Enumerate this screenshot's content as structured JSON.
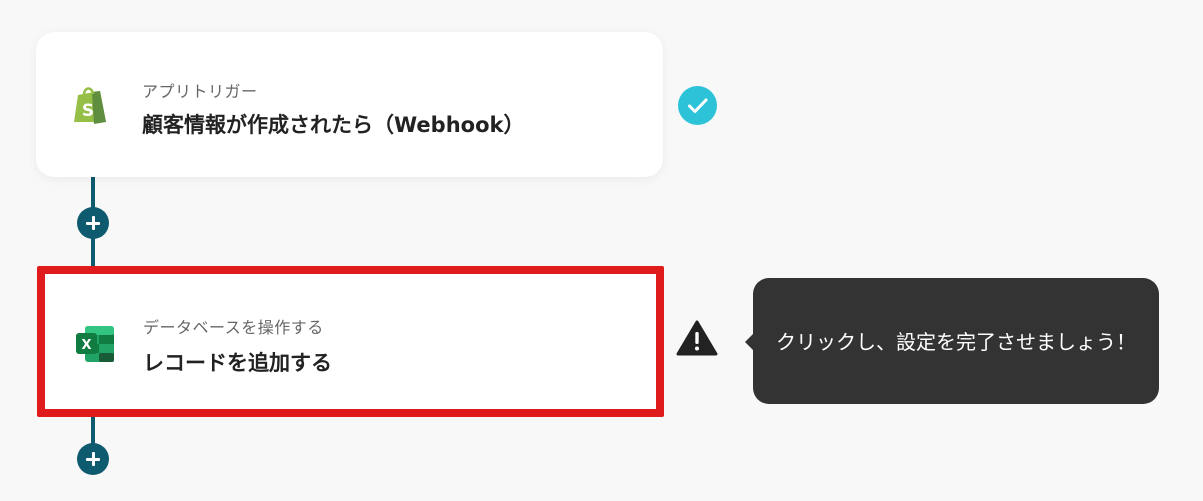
{
  "flow": {
    "steps": [
      {
        "subtitle": "アプリトリガー",
        "title": "顧客情報が作成されたら（Webhook）",
        "icon": "shopify-icon",
        "status": "completed"
      },
      {
        "subtitle": "データベースを操作する",
        "title": "レコードを追加する",
        "icon": "excel-icon",
        "status": "warning"
      }
    ]
  },
  "tooltip": {
    "text": "クリックし、設定を完了させましょう！"
  },
  "colors": {
    "background": "#f8f8f8",
    "connector": "#0e5a6e",
    "check": "#2cc3d8",
    "highlight_border": "#e01b1b",
    "tooltip_bg": "#333333",
    "shopify_green": "#95bf47",
    "excel_green": "#107c41"
  }
}
